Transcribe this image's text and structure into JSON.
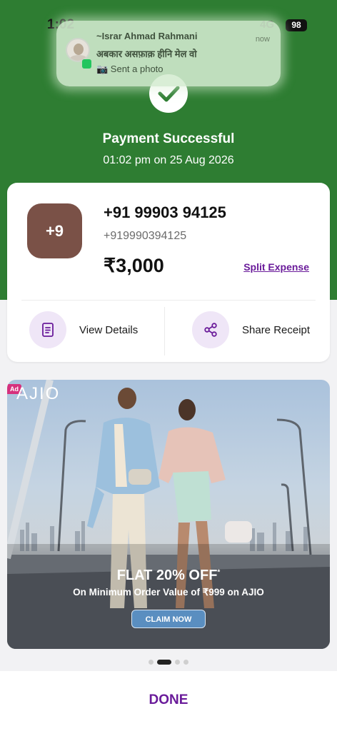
{
  "status_bar": {
    "time": "1:02",
    "network": "4G",
    "battery": "98"
  },
  "notification": {
    "sender": "~Israr Ahmad Rahmani",
    "subtitle": "अबकार असफ़ाक़ हीनि मेल वो",
    "message": "📷 Sent a photo",
    "time": "now"
  },
  "payment": {
    "status_title": "Payment Successful",
    "timestamp": "01:02 pm on 25 Aug 2026"
  },
  "payee": {
    "avatar_text": "+9",
    "name": "+91 99903 94125",
    "number": "+919990394125",
    "amount": "₹3,000",
    "split_label": "Split Expense"
  },
  "actions": {
    "view_details": "View Details",
    "share_receipt": "Share Receipt"
  },
  "ad": {
    "badge": "Ad",
    "brand": "AJIO",
    "headline": "FLAT 20% OFF",
    "headline_mark": "*",
    "subtext": "On Minimum Order Value of ₹999 on AJIO",
    "cta": "CLAIM NOW"
  },
  "carousel": {
    "count": 4,
    "active_index": 1
  },
  "footer": {
    "done_label": "DONE"
  },
  "colors": {
    "success_green": "#2e7d32",
    "accent_purple": "#6a1b9a",
    "avatar_brown": "#7a5147"
  }
}
